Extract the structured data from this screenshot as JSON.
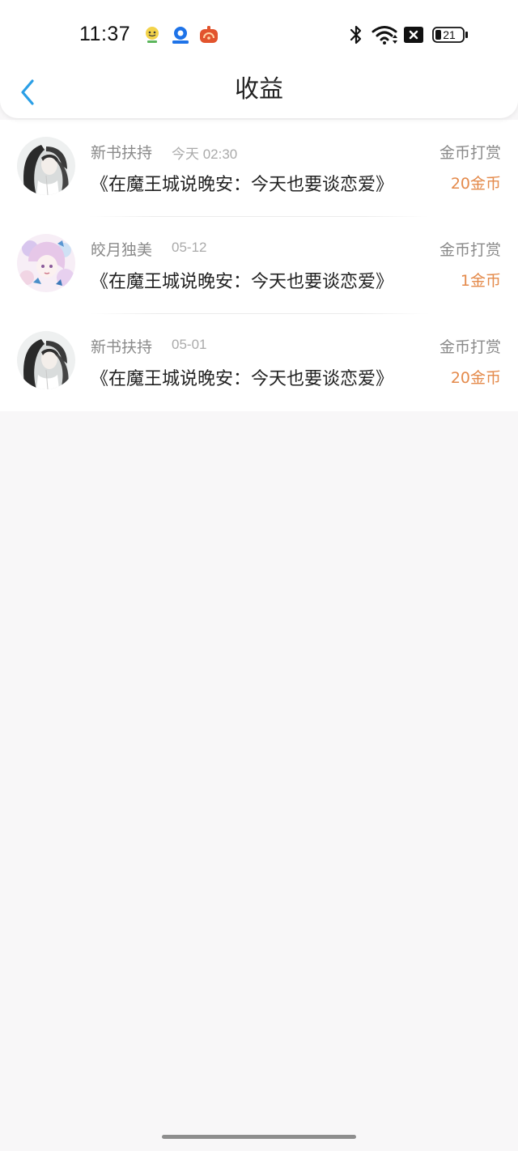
{
  "status_bar": {
    "time": "11:37",
    "battery_level": "21",
    "notification_icons": [
      "smiley-app-icon",
      "location-app-icon",
      "radio-app-icon"
    ],
    "system_icons": [
      "bluetooth-icon",
      "wifi-icon",
      "no-sim-icon",
      "battery-icon"
    ]
  },
  "header": {
    "title": "收益",
    "back_icon": "chevron-left-icon",
    "accent_color": "#2b9fe6"
  },
  "records": [
    {
      "avatar": "ink-portrait",
      "name": "新书扶持",
      "time": "今天 02:30",
      "type": "金币打赏",
      "book": "《在魔王城说晚安：今天也要谈恋爱》",
      "amount": "20金币"
    },
    {
      "avatar": "pastel-portrait",
      "name": "皎月独美",
      "time": "05-12",
      "type": "金币打赏",
      "book": "《在魔王城说晚安：今天也要谈恋爱》",
      "amount": "1金币"
    },
    {
      "avatar": "ink-portrait",
      "name": "新书扶持",
      "time": "05-01",
      "type": "金币打赏",
      "book": "《在魔王城说晚安：今天也要谈恋爱》",
      "amount": "20金币"
    }
  ],
  "colors": {
    "amount": "#e48a4b",
    "secondary_text": "#8a8a8a",
    "page_background": "#f8f7f8"
  }
}
